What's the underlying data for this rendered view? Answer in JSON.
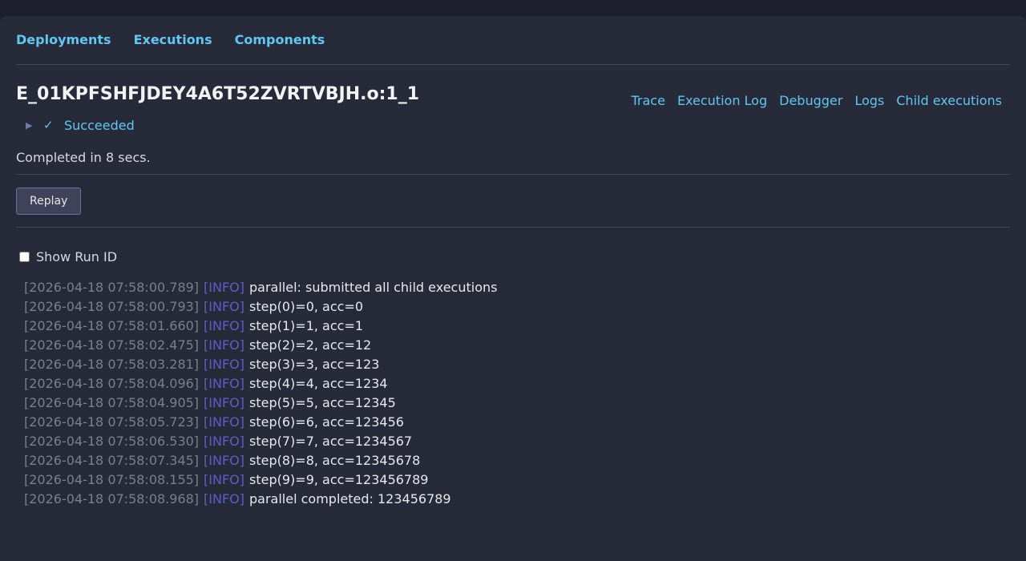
{
  "nav": {
    "deployments": "Deployments",
    "executions": "Executions",
    "components": "Components"
  },
  "execution": {
    "id": "E_01KPFSHFJDEY4A6T52ZVRTVBJH.o:1_1",
    "status": "Succeeded",
    "completed_text": "Completed in 8 secs."
  },
  "tabs": {
    "trace": "Trace",
    "execution_log": "Execution Log",
    "debugger": "Debugger",
    "logs": "Logs",
    "child_executions": "Child executions"
  },
  "actions": {
    "replay_label": "Replay"
  },
  "options": {
    "show_run_id_label": "Show Run ID",
    "show_run_id_checked": false
  },
  "icons": {
    "expand": "triangle-right-icon",
    "success": "check-icon"
  },
  "colors": {
    "link": "#5ec8f2",
    "info_level": "#5b5fc7",
    "timestamp": "#7b7e8c",
    "panel_bg": "#272a38"
  },
  "log_lines": [
    {
      "ts": "[2026-04-18 07:58:00.789]",
      "level": "[INFO]",
      "msg": "parallel: submitted all child executions"
    },
    {
      "ts": "[2026-04-18 07:58:00.793]",
      "level": "[INFO]",
      "msg": "step(0)=0, acc=0"
    },
    {
      "ts": "[2026-04-18 07:58:01.660]",
      "level": "[INFO]",
      "msg": "step(1)=1, acc=1"
    },
    {
      "ts": "[2026-04-18 07:58:02.475]",
      "level": "[INFO]",
      "msg": "step(2)=2, acc=12"
    },
    {
      "ts": "[2026-04-18 07:58:03.281]",
      "level": "[INFO]",
      "msg": "step(3)=3, acc=123"
    },
    {
      "ts": "[2026-04-18 07:58:04.096]",
      "level": "[INFO]",
      "msg": "step(4)=4, acc=1234"
    },
    {
      "ts": "[2026-04-18 07:58:04.905]",
      "level": "[INFO]",
      "msg": "step(5)=5, acc=12345"
    },
    {
      "ts": "[2026-04-18 07:58:05.723]",
      "level": "[INFO]",
      "msg": "step(6)=6, acc=123456"
    },
    {
      "ts": "[2026-04-18 07:58:06.530]",
      "level": "[INFO]",
      "msg": "step(7)=7, acc=1234567"
    },
    {
      "ts": "[2026-04-18 07:58:07.345]",
      "level": "[INFO]",
      "msg": "step(8)=8, acc=12345678"
    },
    {
      "ts": "[2026-04-18 07:58:08.155]",
      "level": "[INFO]",
      "msg": "step(9)=9, acc=123456789"
    },
    {
      "ts": "[2026-04-18 07:58:08.968]",
      "level": "[INFO]",
      "msg": "parallel completed: 123456789"
    }
  ]
}
